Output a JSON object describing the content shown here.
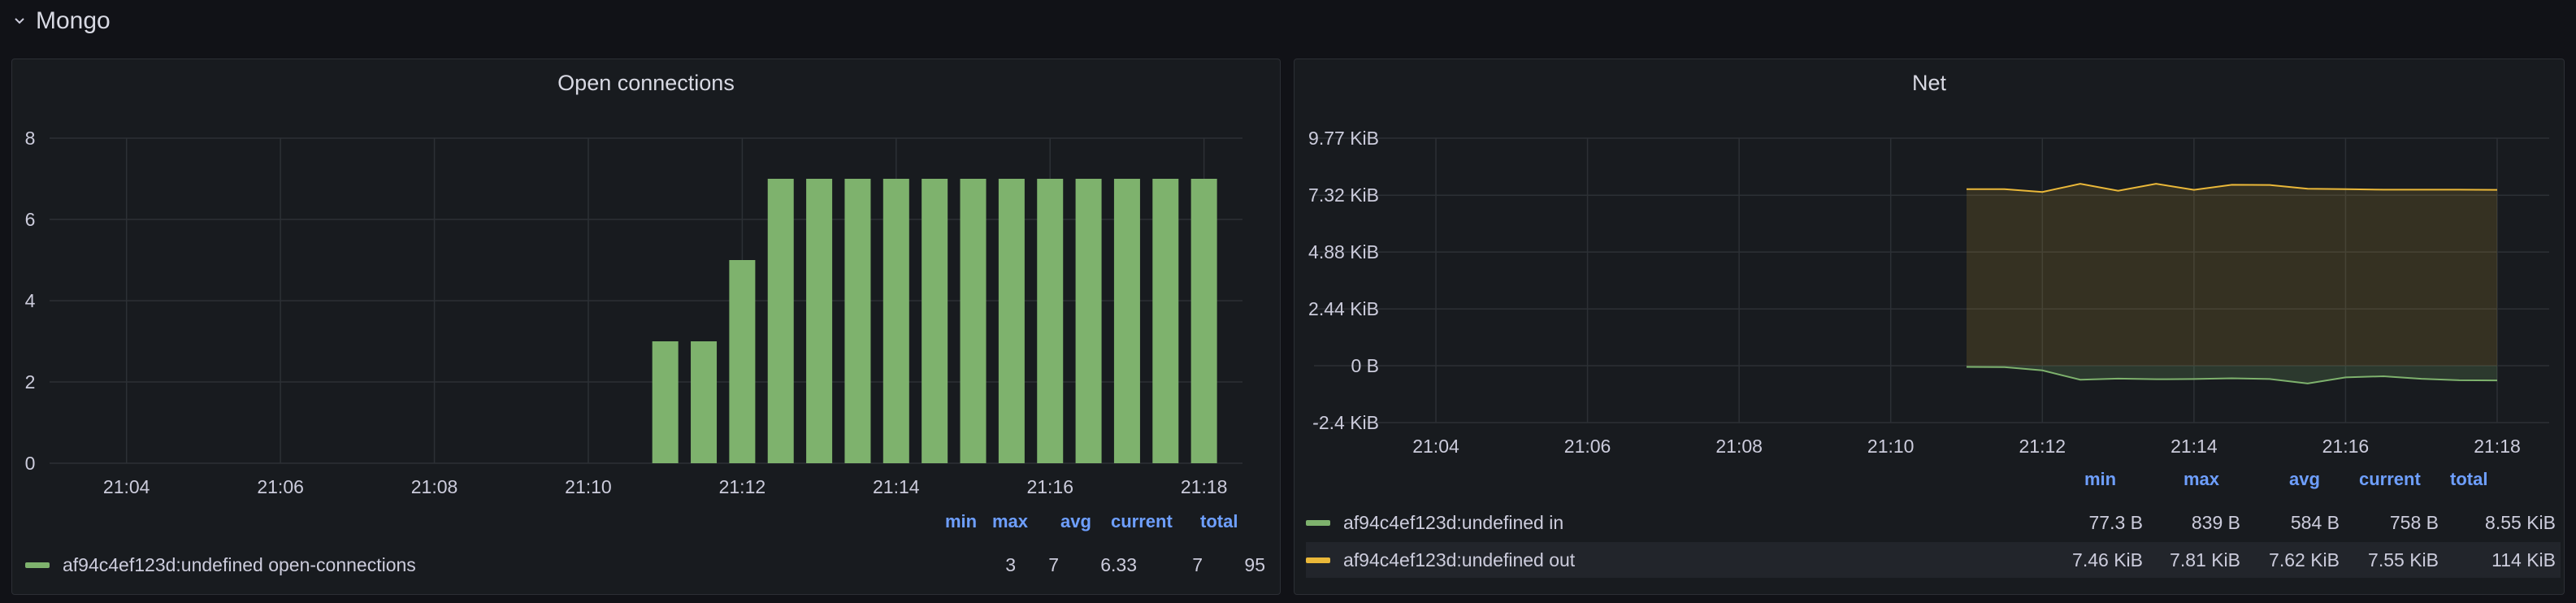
{
  "row": {
    "title": "Mongo"
  },
  "colors": {
    "green": "#7eb26d",
    "yellow": "#eab839",
    "grid": "#2c3035",
    "text": "#ccccdc",
    "legend_header": "#6e9fff"
  },
  "panels": {
    "left": {
      "title": "Open connections",
      "legend_headers": [
        "min",
        "max",
        "avg",
        "current",
        "total"
      ],
      "legend_rows": [
        {
          "name": "af94c4ef123d:undefined open-connections",
          "color": "#7eb26d",
          "min": "3",
          "max": "7",
          "avg": "6.33",
          "current": "7",
          "total": "95"
        }
      ]
    },
    "right": {
      "title": "Net",
      "legend_headers": [
        "min",
        "max",
        "avg",
        "current",
        "total"
      ],
      "legend_rows": [
        {
          "name": "af94c4ef123d:undefined in",
          "color": "#7eb26d",
          "min": "77.3 B",
          "max": "839 B",
          "avg": "584 B",
          "current": "758 B",
          "total": "8.55 KiB"
        },
        {
          "name": "af94c4ef123d:undefined out",
          "color": "#eab839",
          "min": "7.46 KiB",
          "max": "7.81 KiB",
          "avg": "7.62 KiB",
          "current": "7.55 KiB",
          "total": "114 KiB"
        }
      ]
    }
  },
  "chart_data": [
    {
      "type": "bar",
      "title": "Open connections",
      "x_ticks": [
        "21:04",
        "21:06",
        "21:08",
        "21:10",
        "21:12",
        "21:14",
        "21:16",
        "21:18"
      ],
      "y_ticks": [
        "0",
        "2",
        "4",
        "6",
        "8"
      ],
      "ylim": [
        0,
        8
      ],
      "x_range_minutes": [
        "21:03",
        "21:18.5"
      ],
      "series": [
        {
          "name": "af94c4ef123d:undefined open-connections",
          "color": "#7eb26d",
          "x": [
            "21:11",
            "21:11.5",
            "21:12",
            "21:12.5",
            "21:13",
            "21:13.5",
            "21:14",
            "21:14.5",
            "21:15",
            "21:15.5",
            "21:16",
            "21:16.5",
            "21:17",
            "21:17.5",
            "21:18"
          ],
          "values": [
            3,
            3,
            5,
            7,
            7,
            7,
            7,
            7,
            7,
            7,
            7,
            7,
            7,
            7,
            7
          ]
        }
      ],
      "grid": true,
      "legend_placement": "bottom"
    },
    {
      "type": "area",
      "title": "Net",
      "x_ticks": [
        "21:04",
        "21:06",
        "21:08",
        "21:10",
        "21:12",
        "21:14",
        "21:16",
        "21:18"
      ],
      "y_ticks": [
        "9.77 KiB",
        "7.32 KiB",
        "4.88 KiB",
        "2.44 KiB",
        "0 B",
        "-2.4 KiB"
      ],
      "ylim_kib": [
        -2.44,
        9.77
      ],
      "series": [
        {
          "name": "af94c4ef123d:undefined in",
          "color": "#7eb26d",
          "x": [
            "21:11",
            "21:11.5",
            "21:12",
            "21:12.5",
            "21:13",
            "21:13.5",
            "21:14",
            "21:14.5",
            "21:15",
            "21:15.5",
            "21:16",
            "21:16.5",
            "21:17",
            "21:17.5",
            "21:18"
          ],
          "values_kib": [
            -0.05,
            -0.06,
            -0.2,
            -0.6,
            -0.55,
            -0.58,
            -0.57,
            -0.54,
            -0.57,
            -0.76,
            -0.5,
            -0.45,
            -0.56,
            -0.62,
            -0.63
          ]
        },
        {
          "name": "af94c4ef123d:undefined out",
          "color": "#eab839",
          "x": [
            "21:11",
            "21:11.5",
            "21:12",
            "21:12.5",
            "21:13",
            "21:13.5",
            "21:14",
            "21:14.5",
            "21:15",
            "21:15.5",
            "21:16",
            "21:16.5",
            "21:17",
            "21:17.5",
            "21:18"
          ],
          "values_kib": [
            7.58,
            7.58,
            7.46,
            7.81,
            7.51,
            7.81,
            7.55,
            7.77,
            7.76,
            7.6,
            7.58,
            7.56,
            7.56,
            7.56,
            7.55
          ]
        }
      ],
      "grid": true,
      "legend_placement": "bottom"
    }
  ]
}
